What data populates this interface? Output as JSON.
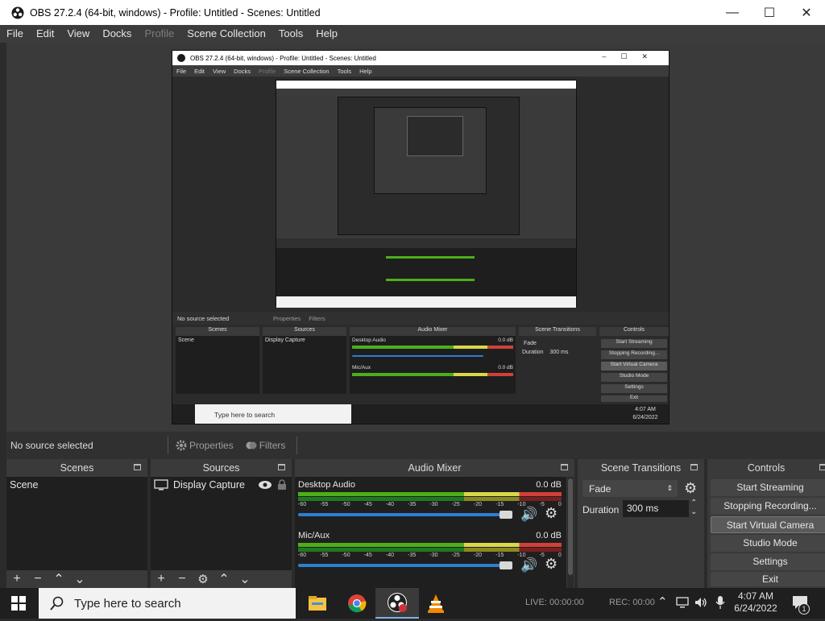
{
  "window": {
    "title": "OBS 27.2.4 (64-bit, windows) - Profile: Untitled - Scenes: Untitled",
    "controls": {
      "minimize": "—",
      "maximize": "☐",
      "close": "✕"
    }
  },
  "menu": [
    "File",
    "Edit",
    "View",
    "Docks",
    "Profile",
    "Scene Collection",
    "Tools",
    "Help"
  ],
  "preview": {
    "nested_title": "OBS 27.2.4 (64-bit, windows) - Profile: Untitled - Scenes: Untitled",
    "nested_menu": [
      "File",
      "Edit",
      "View",
      "Docks",
      "Profile",
      "Scene Collection",
      "Tools",
      "Help"
    ],
    "nested_no_source": "No source selected",
    "nested_properties": "Properties",
    "nested_filters": "Filters",
    "nested_docks": [
      "Scenes",
      "Sources",
      "Audio Mixer",
      "Scene Transitions",
      "Controls"
    ],
    "nested_scene": "Scene",
    "nested_source": "Display Capture",
    "nested_desktop_audio": "Desktop Audio",
    "nested_mic": "Mic/Aux",
    "nested_db": "0.0 dB",
    "nested_fade": "Fade",
    "nested_duration_label": "Duration",
    "nested_duration": "300 ms",
    "nested_controls": [
      "Start Streaming",
      "Stopping Recording...",
      "Start Virtual Camera",
      "Studio Mode",
      "Settings",
      "Exit"
    ],
    "nested_search": "Type here to search",
    "nested_time": "4:07 AM",
    "nested_date": "6/24/2022"
  },
  "properties_bar": {
    "no_source": "No source selected",
    "properties": "Properties",
    "filters": "Filters"
  },
  "scenes": {
    "title": "Scenes",
    "items": [
      "Scene"
    ]
  },
  "sources": {
    "title": "Sources",
    "items": [
      "Display Capture"
    ]
  },
  "mixer": {
    "title": "Audio Mixer",
    "channels": [
      {
        "name": "Desktop Audio",
        "db": "0.0 dB"
      },
      {
        "name": "Mic/Aux",
        "db": "0.0 dB"
      }
    ],
    "ticks": [
      "-60",
      "-55",
      "-50",
      "-45",
      "-40",
      "-35",
      "-30",
      "-25",
      "-20",
      "-15",
      "-10",
      "-5",
      "0"
    ]
  },
  "transitions": {
    "title": "Scene Transitions",
    "selected": "Fade",
    "duration_label": "Duration",
    "duration_value": "300 ms"
  },
  "controls": {
    "title": "Controls",
    "buttons": [
      "Start Streaming",
      "Stopping Recording...",
      "Start Virtual Camera",
      "Studio Mode",
      "Settings",
      "Exit"
    ]
  },
  "taskbar": {
    "search_placeholder": "Type here to search",
    "time": "4:07 AM",
    "date": "6/24/2022",
    "live": "LIVE: 00:00:00",
    "rec": "REC: 00:00",
    "notification_count": "1"
  },
  "colors": {
    "accent": "#2d7fd0",
    "panel_bg": "#3a3a3a",
    "list_bg": "#1f1f1f"
  }
}
